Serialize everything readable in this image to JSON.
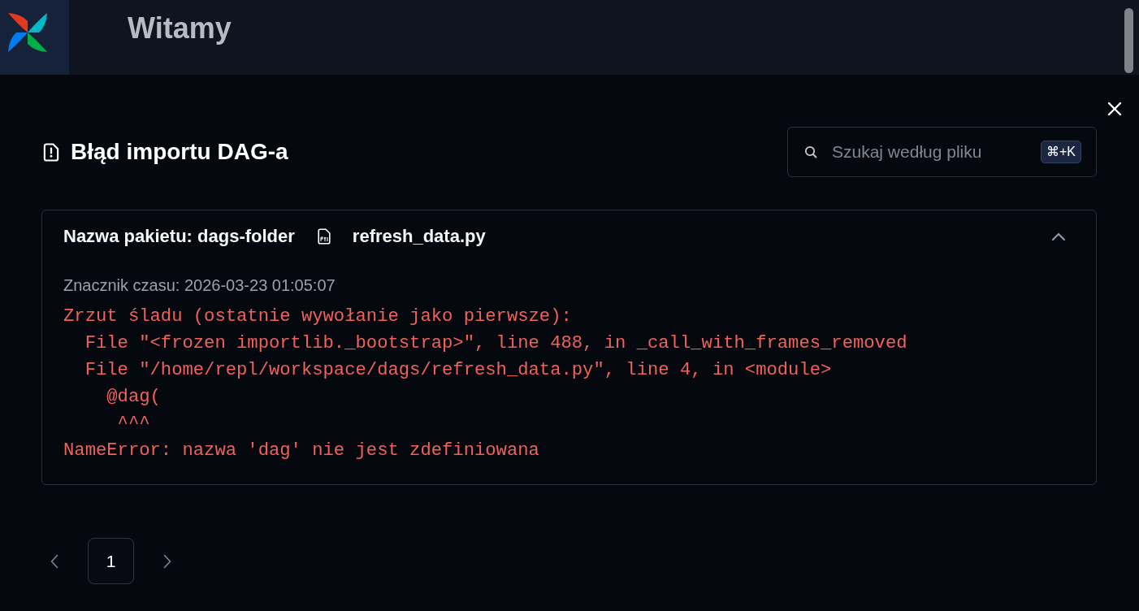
{
  "header": {
    "title": "Witamy"
  },
  "dialog": {
    "title": "Błąd importu DAG-a",
    "search": {
      "placeholder": "Szukaj według pliku",
      "shortcut": "⌘+K"
    },
    "errors": [
      {
        "bundle": "Nazwa pakietu: dags-folder",
        "file": "refresh_data.py",
        "expanded": true,
        "timestamp": "Znacznik czasu: 2026-03-23 01:05:07",
        "traceback": [
          "Zrzut śladu (ostatnie wywołanie jako pierwsze):",
          "  File \"<frozen importlib._bootstrap>\", line 488, in _call_with_frames_removed",
          "  File \"/home/repl/workspace/dags/refresh_data.py\", line 4, in <module>",
          "    @dag(",
          "     ^^^",
          "NameError: nazwa 'dag' nie jest zdefiniowana"
        ]
      }
    ],
    "pagination": {
      "pages": [
        {
          "label": "1",
          "selected": true
        }
      ]
    }
  }
}
